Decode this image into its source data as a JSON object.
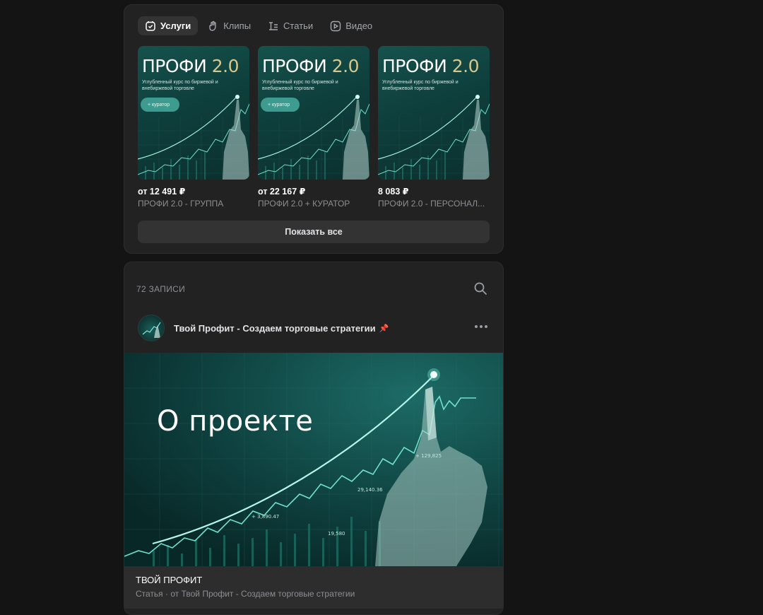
{
  "tabs": [
    {
      "label": "Услуги",
      "icon": "services-icon",
      "active": true
    },
    {
      "label": "Клипы",
      "icon": "clips-icon",
      "active": false
    },
    {
      "label": "Статьи",
      "icon": "articles-icon",
      "active": false
    },
    {
      "label": "Видео",
      "icon": "video-icon",
      "active": false
    }
  ],
  "products": [
    {
      "thumb_title": "ПРОФИ",
      "thumb_version": "2.0",
      "thumb_sub": "Углубленный курс по биржевой и внебиржевой торговле",
      "thumb_pill": "+ куратор",
      "price": "от 12 491 ₽",
      "name": "ПРОФИ 2.0 - ГРУППА"
    },
    {
      "thumb_title": "ПРОФИ",
      "thumb_version": "2.0",
      "thumb_sub": "Углубленный курс по биржевой и внебиржевой торговле",
      "thumb_pill": "+ куратор",
      "price": "от 22 167 ₽",
      "name": "ПРОФИ 2.0 + КУРАТОР"
    },
    {
      "thumb_title": "ПРОФИ",
      "thumb_version": "2.0",
      "thumb_sub": "Углубленный курс по биржевой и внебиржевой торговле",
      "thumb_pill": "",
      "price": "8 083 ₽",
      "name": "ПРОФИ 2.0 - ПЕРСОНАЛ..."
    }
  ],
  "show_all_label": "Показать все",
  "wall": {
    "count_label": "72 ЗАПИСИ",
    "post": {
      "author": "Твой Профит - Создаем торговые стратегии",
      "pin_glyph": "📌",
      "banner_title": "О проекте",
      "banner_tickers": [
        "+ 129,825",
        "29,140.36",
        "+ 3,890.47",
        "19,580"
      ],
      "article_title": "ТВОЙ ПРОФИТ",
      "article_subtitle": "Статья · от Твой Профит - Создаем торговые стратегии"
    }
  },
  "colors": {
    "background": "#141414",
    "card": "#222222",
    "accent_teal": "#3d9c8f",
    "banner_bg": "#0f4442"
  }
}
